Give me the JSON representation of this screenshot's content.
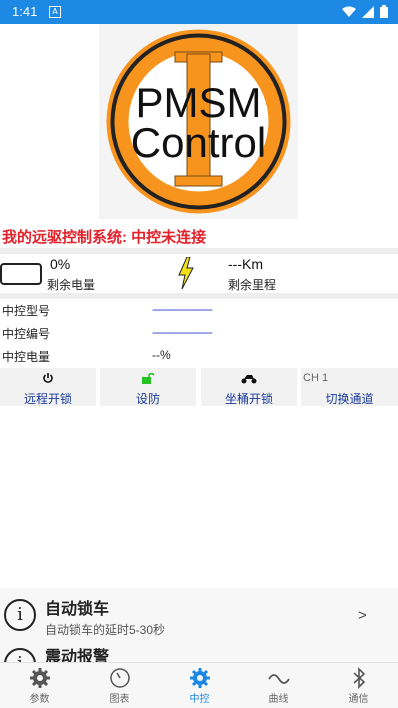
{
  "status_bar": {
    "time": "1:41",
    "notif_glyph": "A"
  },
  "logo": {
    "line1": "PMSM",
    "line2": "Control",
    "letter": "I"
  },
  "title": "我的远驱控制系统: 中控未连接",
  "stats": {
    "battery_value": "0%",
    "battery_label": "剩余电量",
    "range_value": "---Km",
    "range_label": "剩余里程"
  },
  "info": [
    {
      "label": "中控型号",
      "value": "--------------------"
    },
    {
      "label": "中控编号",
      "value": "--------------------"
    },
    {
      "label": "中控电量",
      "value": "--%"
    }
  ],
  "actions": [
    {
      "icon": "power-icon",
      "label": "远程开锁"
    },
    {
      "icon": "unlock-icon",
      "label": "设防",
      "color": "#22c322"
    },
    {
      "icon": "scooter-icon",
      "label": "坐桶开锁"
    },
    {
      "icon": "",
      "channel": "CH 1",
      "label": "切换通道"
    }
  ],
  "settings": [
    {
      "title": "自动锁车",
      "subtitle": "自动锁车的延时5-30秒",
      "chevron": ">"
    },
    {
      "title": "震动报警"
    }
  ],
  "nav": {
    "active": "中控",
    "items": [
      {
        "icon": "gear-icon",
        "label": "参数"
      },
      {
        "icon": "gauge-icon",
        "label": "图表"
      },
      {
        "icon": "gear-icon",
        "label": "中控"
      },
      {
        "icon": "wave-icon",
        "label": "曲线"
      },
      {
        "icon": "bluetooth-icon",
        "label": "通信"
      }
    ]
  },
  "colors": {
    "accent": "#1e88e5",
    "title_red": "#e3212a",
    "logo_orange": "#f7941d"
  }
}
